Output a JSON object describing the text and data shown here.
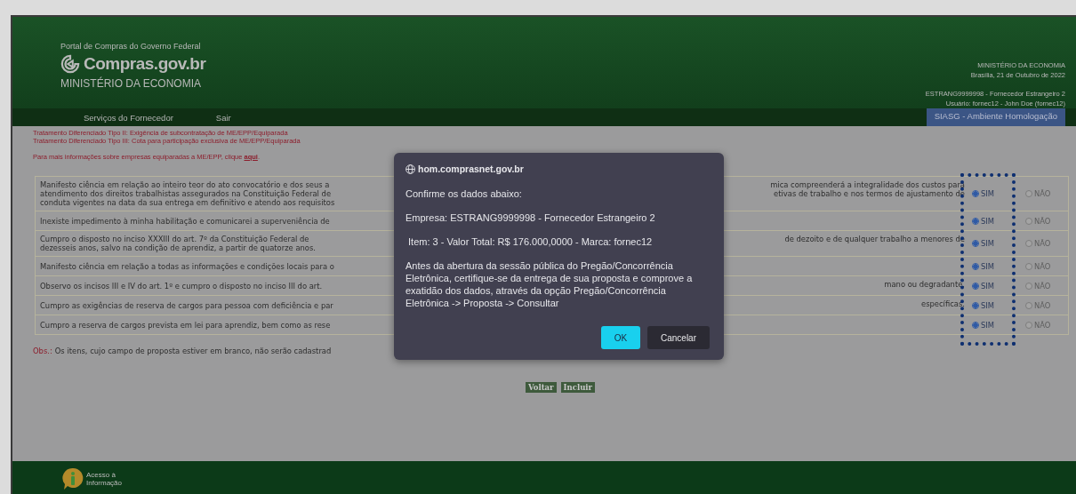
{
  "header": {
    "portal": "Portal de Compras do Governo Federal",
    "logo_text": "Compras.gov.br",
    "ministry": "MINISTÉRIO DA ECONOMIA",
    "right_ministry": "MINISTÉRIO DA ECONOMIA",
    "date": "Brasília, 21 de Outubro de 2022",
    "supplier": "ESTRANG9999998 - Fornecedor Estrangeiro 2",
    "user": "Usuário: fornec12 - John Doe (fornec12)"
  },
  "nav": {
    "items": [
      "Serviços do Fornecedor",
      "Sair"
    ],
    "environment": "SIASG - Ambiente Homologação"
  },
  "notes": [
    "Tratamento Diferenciado Tipo II: Exigência de subcontratação de ME/EPP/Equiparada",
    "Tratamento Diferenciado Tipo III: Cota para participação exclusiva de ME/EPP/Equiparada"
  ],
  "info": {
    "text": "Para mais informações sobre empresas equiparadas a ME/EPP, clique",
    "link": "aqui",
    "end": "."
  },
  "rows": [
    {
      "left": [
        "Manifesto ciência em relação ao inteiro teor do ato convocatório e dos seus a",
        "atendimento dos direitos trabalhistas assegurados na Constituição Federal de",
        "conduta vigentes na data da sua entrega em definitivo e atendo aos requisitos"
      ],
      "right": [
        "mica compreenderá a integralidade dos custos para",
        "etivas de trabalho e nos termos de ajustamento de"
      ],
      "options": [
        {
          "label": "SIM",
          "selected": true
        },
        {
          "label": "NÃO",
          "selected": false
        }
      ]
    },
    {
      "left": [
        "Inexiste impedimento à minha habilitação e comunicarei a superveniência de"
      ],
      "options": [
        {
          "label": "SIM",
          "selected": true
        },
        {
          "label": "NÃO",
          "selected": false
        }
      ]
    },
    {
      "left": [
        "Cumpro o disposto no inciso XXXIII do art. 7º da Constituição Federal de",
        "dezesseis anos, salvo na condição de aprendiz, a partir de quatorze anos."
      ],
      "right": [
        "de dezoito e de qualquer trabalho a menores de"
      ],
      "options": [
        {
          "label": "SIM",
          "selected": true
        },
        {
          "label": "NÃO",
          "selected": false
        }
      ]
    },
    {
      "left": [
        "Manifesto ciência em relação a todas as informações e condições locais para o"
      ],
      "options": [
        {
          "label": "SIM",
          "selected": true
        },
        {
          "label": "NÃO",
          "selected": false
        }
      ]
    },
    {
      "left": [
        "Observo os incisos III e IV do art. 1º e cumpro o disposto no inciso III do art."
      ],
      "right": [
        "mano ou degradante."
      ],
      "options": [
        {
          "label": "SIM",
          "selected": true
        },
        {
          "label": "NÃO",
          "selected": false
        }
      ]
    },
    {
      "left": [
        "Cumpro as exigências de reserva de cargos para pessoa com deficiência e par"
      ],
      "right": [
        "específicas."
      ],
      "options": [
        {
          "label": "SIM",
          "selected": true
        },
        {
          "label": "NÃO",
          "selected": false
        }
      ]
    },
    {
      "left": [
        "Cumpro a reserva de cargos prevista em lei para aprendiz, bem como as rese"
      ],
      "options": [
        {
          "label": "SIM",
          "selected": true
        },
        {
          "label": "NÃO",
          "selected": false
        }
      ]
    }
  ],
  "obs": {
    "label": "Obs.:",
    "text": "Os itens, cujo campo de proposta estiver em branco, não serão cadastrad"
  },
  "buttons": [
    "Voltar",
    "Incluir"
  ],
  "footer": {
    "label": "Acesso à\nInformação"
  },
  "dialog": {
    "origin": "hom.comprasnet.gov.br",
    "lines": [
      "Confirme os dados abaixo:",
      "Empresa: ESTRANG9999998 - Fornecedor Estrangeiro 2",
      " Item: 3 - Valor Total: R$ 176.000,0000 - Marca: fornec12",
      "Antes da abertura da sessão pública do Pregão/Concorrência Eletrônica, certifique-se da entrega de sua proposta e comprove a exatidão dos dados, através da opção Pregão/Concorrência Eletrônica -> Proposta -> Consultar"
    ],
    "buttons": [
      {
        "label": "OK",
        "kind": "primary"
      },
      {
        "label": "Cancelar",
        "kind": "secondary"
      }
    ]
  }
}
